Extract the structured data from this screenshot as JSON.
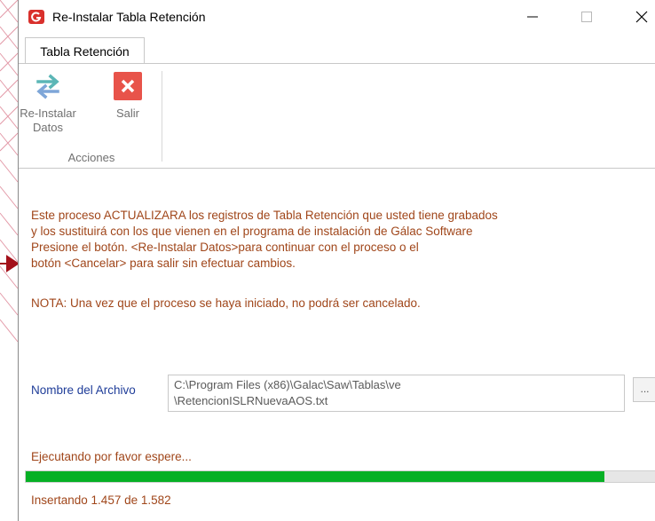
{
  "window": {
    "title": "Re-Instalar Tabla Retención",
    "minimize_glyph": "—",
    "maximize_glyph": "☐",
    "close_glyph": "✕"
  },
  "tabs": [
    {
      "label": "Tabla Retención",
      "active": true
    }
  ],
  "ribbon": {
    "reinstalar": {
      "line1": "Re-Instalar",
      "line2": "Datos",
      "icon": "swap-arrows-icon"
    },
    "salir": {
      "label": "Salir",
      "icon": "close-x-icon"
    },
    "group_label": "Acciones"
  },
  "message": {
    "line1": "Este proceso ACTUALIZARA los registros de Tabla Retención que usted tiene grabados",
    "line2": "y los sustituirá con los que vienen en el programa de instalación de Gálac Software",
    "line3": "Presione el botón.  <Re-Instalar Datos>para continuar con el proceso o el",
    "line4": "botón <Cancelar> para salir sin efectuar cambios.",
    "nota": "NOTA: Una vez que el proceso se haya iniciado, no podrá ser cancelado."
  },
  "file": {
    "label": "Nombre del Archivo",
    "path_line1": "C:\\Program Files (x86)\\Galac\\Saw\\Tablas\\ve",
    "path_line2": "\\RetencionISLRNuevaAOS.txt",
    "browse_label": "..."
  },
  "progress": {
    "status": "Ejecutando por favor espere...",
    "fraction": 0.92,
    "detail": "Insertando 1.457 de 1.582"
  },
  "colors": {
    "message_text": "#a0461a",
    "label_blue": "#1f3d99",
    "progress_green": "#06b025",
    "salir_red": "#e8534a",
    "swap_teal": "#5bb6b6",
    "swap_blue": "#7ea6d8",
    "app_icon_red": "#d9302c"
  }
}
